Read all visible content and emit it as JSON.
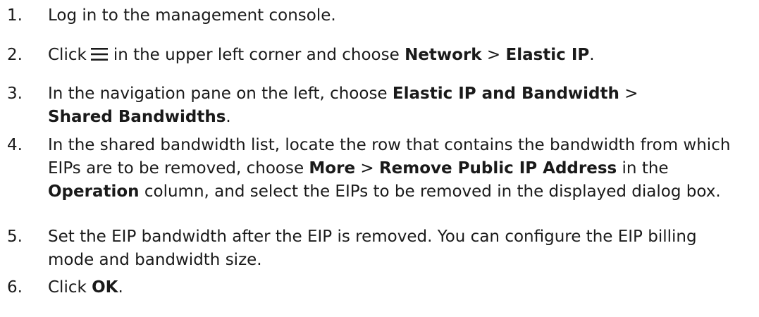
{
  "steps": [
    {
      "number": "1.",
      "text": "Log in to the management console."
    },
    {
      "number": "2.",
      "prefix": "Click",
      "icon": "menu-icon",
      "middle": "in the upper left corner and choose",
      "bold1": "Network",
      "sep": ">",
      "bold2": "Elastic IP",
      "end": "."
    },
    {
      "number": "3.",
      "prefix": "In the navigation pane on the left, choose",
      "bold1": "Elastic IP and Bandwidth",
      "sep": ">",
      "bold2": "Shared Bandwidths",
      "end": "."
    },
    {
      "number": "4.",
      "prefix": "In the shared bandwidth list, locate the row that contains the bandwidth from which EIPs are to be removed, choose",
      "bold1": "More",
      "sep": ">",
      "bold2": "Remove Public IP Address",
      "middle": "in the",
      "bold3": "Operation",
      "end": "column, and select the EIPs to be removed in the displayed dialog box."
    },
    {
      "number": "5.",
      "text": "Set the EIP bandwidth after the EIP is removed. You can configure the EIP billing mode and bandwidth size."
    },
    {
      "number": "6.",
      "prefix": "Click",
      "bold1": "OK",
      "end": "."
    }
  ]
}
